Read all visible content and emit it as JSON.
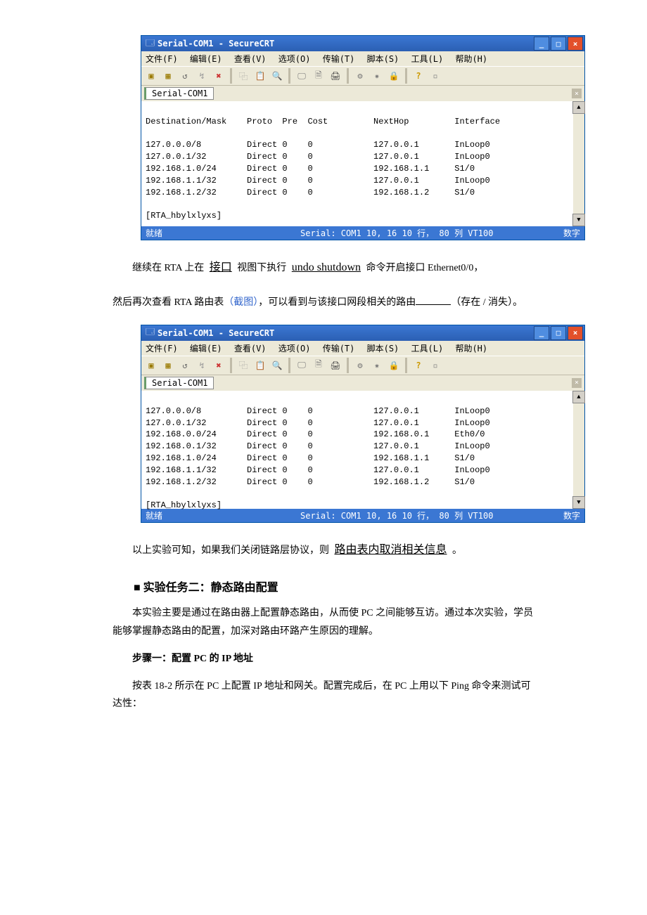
{
  "window1": {
    "title": "Serial-COM1 - SecureCRT",
    "menus": [
      "文件(F)",
      "编辑(E)",
      "查看(V)",
      "选项(O)",
      "传输(T)",
      "脚本(S)",
      "工具(L)",
      "帮助(H)"
    ],
    "tab": "Serial-COM1",
    "terminal_lines": [
      "Destination/Mask    Proto  Pre  Cost         NextHop         Interface",
      "",
      "127.0.0.0/8         Direct 0    0            127.0.0.1       InLoop0",
      "127.0.0.1/32        Direct 0    0            127.0.0.1       InLoop0",
      "192.168.1.0/24      Direct 0    0            192.168.1.1     S1/0",
      "192.168.1.1/32      Direct 0    0            127.0.0.1       InLoop0",
      "192.168.1.2/32      Direct 0    0            192.168.1.2     S1/0",
      "",
      "[RTA_hbylxlyxs]"
    ],
    "status": {
      "left": "就绪",
      "mid": "Serial: COM1   10,  16   10 行， 80 列  VT100",
      "right": "数字"
    }
  },
  "para1": {
    "pre1": "继续在 RTA 上在",
    "fill1": "接口",
    "pre2": "视图下执行",
    "fill2": "undo shutdown",
    "post2": "命令开启接口 Ethernet0/0，",
    "line2a": "然后再次查看 RTA 路由表",
    "link": "（截图）",
    "line2b": "，可以看到与该接口网段相关的路由",
    "line2c": "（存在 / 消失）。"
  },
  "window2": {
    "title": "Serial-COM1 - SecureCRT",
    "menus": [
      "文件(F)",
      "编辑(E)",
      "查看(V)",
      "选项(O)",
      "传输(T)",
      "脚本(S)",
      "工具(L)",
      "帮助(H)"
    ],
    "tab": "Serial-COM1",
    "terminal_lines": [
      "127.0.0.0/8         Direct 0    0            127.0.0.1       InLoop0",
      "127.0.0.1/32        Direct 0    0            127.0.0.1       InLoop0",
      "192.168.0.0/24      Direct 0    0            192.168.0.1     Eth0/0",
      "192.168.0.1/32      Direct 0    0            127.0.0.1       InLoop0",
      "192.168.1.0/24      Direct 0    0            192.168.1.1     S1/0",
      "192.168.1.1/32      Direct 0    0            127.0.0.1       InLoop0",
      "192.168.1.2/32      Direct 0    0            192.168.1.2     S1/0",
      "",
      "[RTA_hbylxlyxs]"
    ],
    "status": {
      "left": "就绪",
      "mid": "Serial: COM1   10,  16   10 行， 80 列  VT100",
      "right": "数字"
    }
  },
  "para2": {
    "pre": "以上实验可知，如果我们关闭链路层协议，则",
    "fill": "路由表内取消相关信息",
    "post": "。"
  },
  "task2": {
    "heading": "■ 实验任务二：静态路由配置",
    "p1": "本实验主要是通过在路由器上配置静态路由，从而使 PC 之间能够互访。通过本次实验，学员能够掌握静态路由的配置，加深对路由环路产生原因的理解。",
    "step_title": "步骤一：配置 PC 的 IP 地址",
    "p2": "按表 18-2 所示在 PC 上配置 IP 地址和网关。配置完成后，在 PC 上用以下 Ping 命令来测试可达性："
  },
  "icons": {
    "min": "_",
    "max": "□",
    "close": "×",
    "up": "▲",
    "down": "▼",
    "tabx": "×",
    "help": "?"
  }
}
